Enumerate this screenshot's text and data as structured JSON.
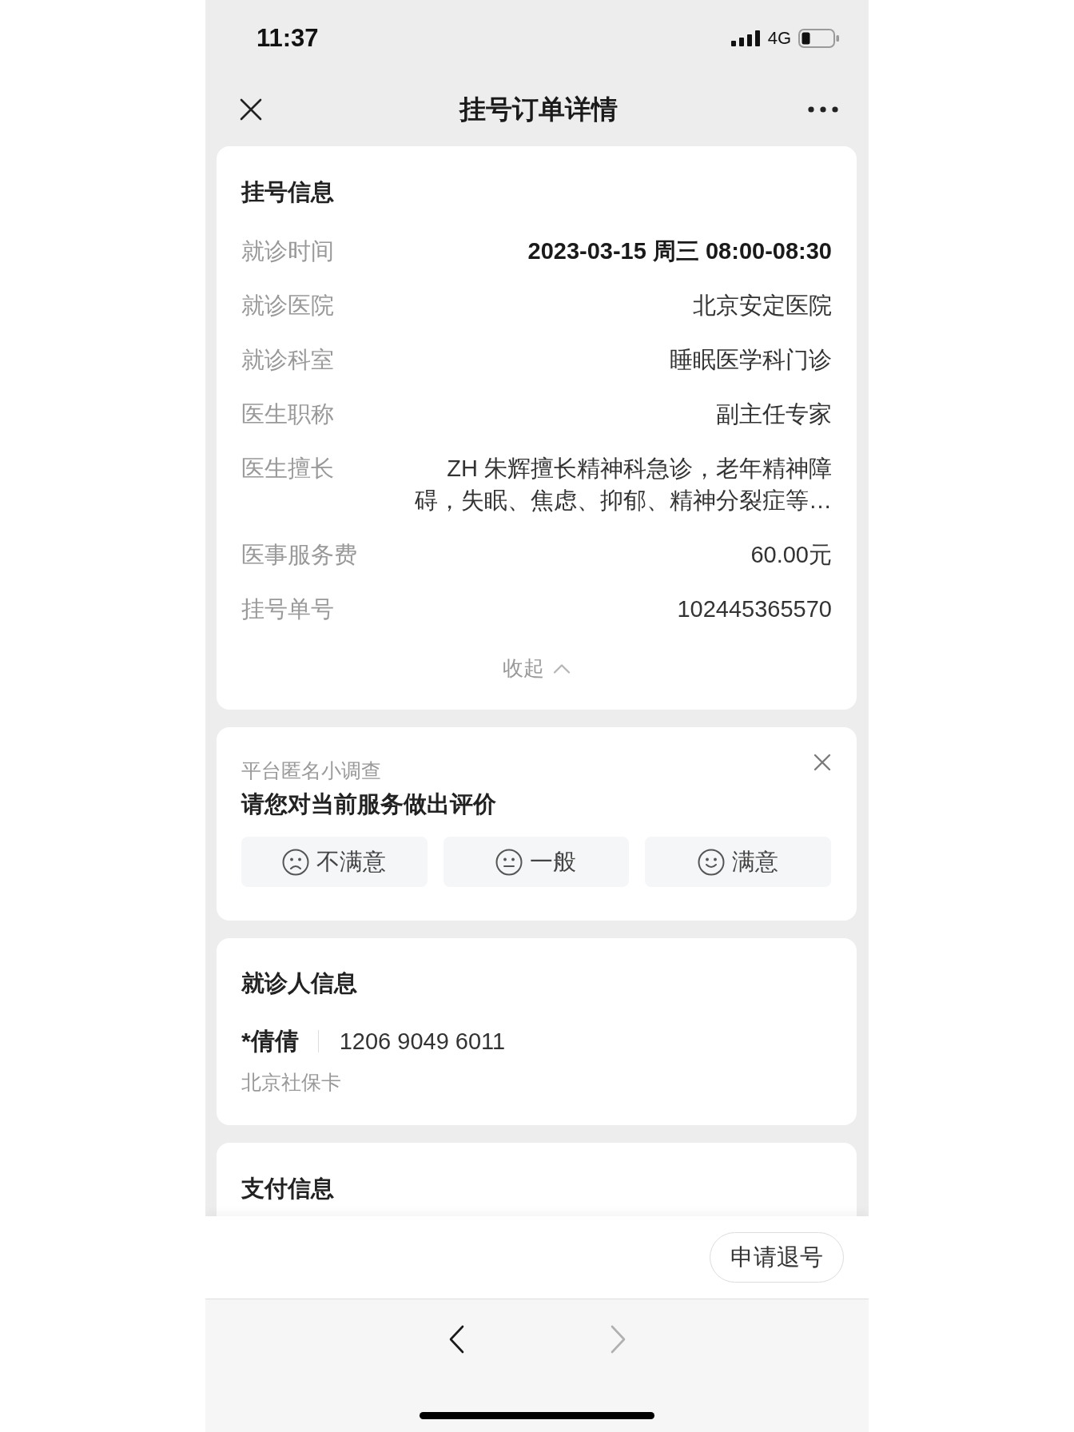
{
  "status_bar": {
    "time": "11:37",
    "network": "4G"
  },
  "nav_bar": {
    "title": "挂号订单详情"
  },
  "registration": {
    "title": "挂号信息",
    "rows": [
      {
        "label": "就诊时间",
        "value": "2023-03-15 周三 08:00-08:30",
        "highlighted": true
      },
      {
        "label": "就诊医院",
        "value": "北京安定医院",
        "highlighted": false
      },
      {
        "label": "就诊科室",
        "value": "睡眠医学科门诊",
        "highlighted": false
      },
      {
        "label": "医生职称",
        "value": "副主任专家",
        "highlighted": false
      },
      {
        "label": "医生擅长",
        "value": "ZH 朱辉擅长精神科急诊，老年精神障碍，失眠、焦虑、抑郁、精神分裂症等…",
        "highlighted": false
      },
      {
        "label": "医事服务费",
        "value": "60.00元",
        "highlighted": false
      },
      {
        "label": "挂号单号",
        "value": "102445365570",
        "highlighted": false
      }
    ],
    "expanded": true,
    "toggle_label": "收起"
  },
  "survey": {
    "caption": "平台匿名小调查",
    "question": "请您对当前服务做出评价",
    "options": [
      {
        "label": "不满意",
        "kind": "sad"
      },
      {
        "label": "一般",
        "kind": "neutral"
      },
      {
        "label": "满意",
        "kind": "happy"
      }
    ]
  },
  "patient": {
    "title": "就诊人信息",
    "name": "*倩倩",
    "card_number": "1206 9049 6011",
    "card_type": "北京社保卡"
  },
  "payment": {
    "title": "支付信息"
  },
  "action_bar": {
    "button": "申请退号"
  },
  "browser_toolbar": {
    "back": {
      "disabled": false
    },
    "forward": {
      "disabled": true
    }
  }
}
